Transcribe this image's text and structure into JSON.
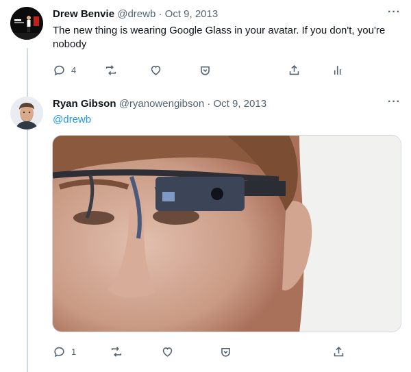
{
  "tweet1": {
    "name": "Drew Benvie",
    "handle": "@drewb",
    "separator": "·",
    "date": "Oct 9, 2013",
    "text": "The new thing is wearing Google Glass in your avatar. If you don't, you're nobody",
    "reply_count": "4",
    "more_label": "···"
  },
  "tweet2": {
    "name": "Ryan Gibson",
    "handle": "@ryanowengibson",
    "separator": "·",
    "date": "Oct 9, 2013",
    "mention": "@drewb",
    "reply_count": "1",
    "more_label": "···"
  },
  "colors": {
    "accent": "#1d9bf0",
    "text": "#0f1419",
    "secondary": "#536471",
    "thread_line": "#cfd9de"
  },
  "icons": [
    "reply-icon",
    "retweet-icon",
    "like-icon",
    "share-dropdown-icon",
    "share-icon",
    "analytics-icon",
    "more-icon"
  ]
}
